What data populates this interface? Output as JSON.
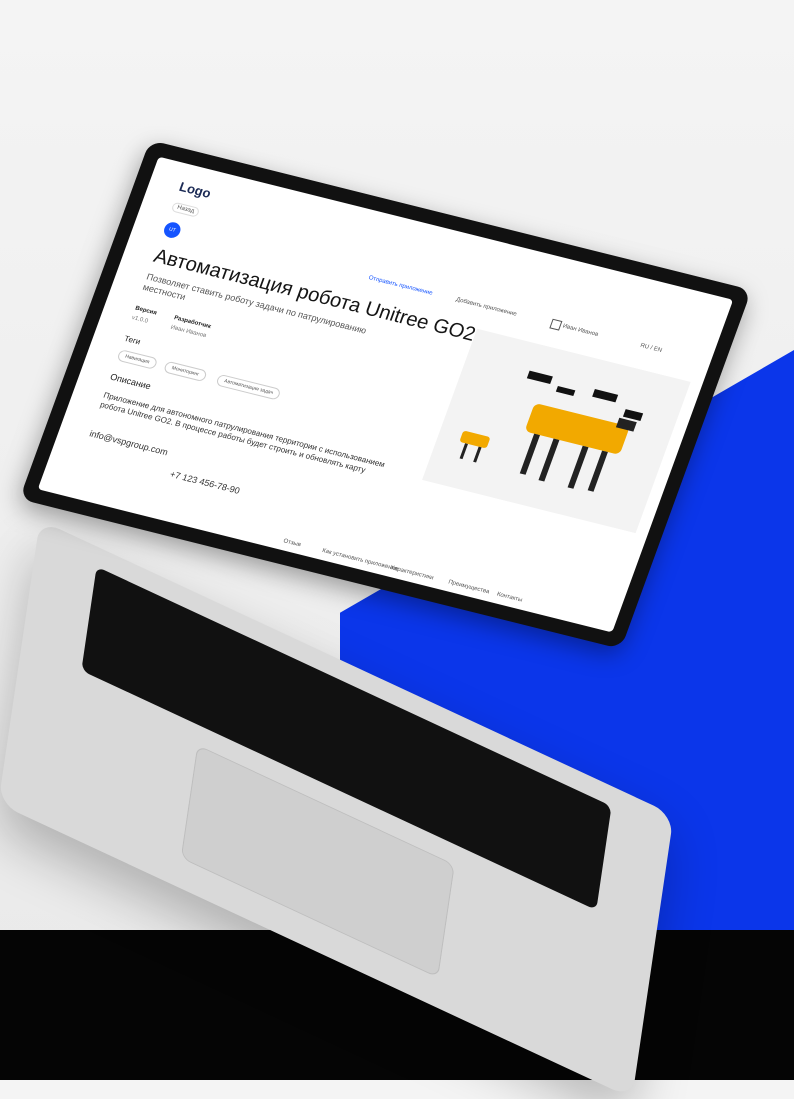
{
  "app": {
    "logo": "Logo",
    "back_label": "Назад",
    "avatar_initials": "UT"
  },
  "nav": {
    "share": "Отправить приложение",
    "add": "Добавить приложение",
    "user": "Иван Иванов",
    "language": "RU / EN"
  },
  "content": {
    "title": "Автоматизация робота Unitree GO2",
    "subtitle": "Позволяет ставить роботу задачи по патрулированию местности",
    "version_label": "Версия",
    "version_value": "v1.0.0",
    "developer_label": "Разработчик",
    "developer_value": "Иван Иванов",
    "tags_label": "Теги",
    "tags": [
      "Навигация",
      "Мониторинг",
      "Автоматизация задач"
    ],
    "description_label": "Описание",
    "description_text": "Приложение для автономного патрулирования территории с использованием робота Unitree GO2. В процессе работы будет строить и обновлять карту",
    "email": "info@vspgroup.com",
    "phone": "+7 123 456-78-90"
  },
  "footer": {
    "links": [
      "Отзыв",
      "Как установить приложение",
      "Характеристики",
      "Преимущества",
      "Контакты"
    ]
  }
}
